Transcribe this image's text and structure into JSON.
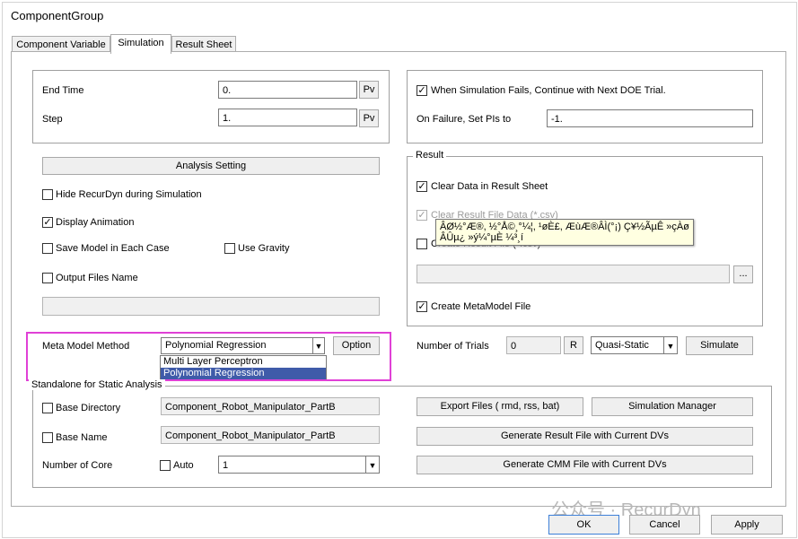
{
  "window": {
    "title": "ComponentGroup"
  },
  "tabs": [
    "Component Variable",
    "Simulation",
    "Result Sheet"
  ],
  "time": {
    "end_time_label": "End Time",
    "end_time_value": "0.",
    "pv1": "Pv",
    "step_label": "Step",
    "step_value": "1.",
    "pv2": "Pv"
  },
  "failure": {
    "continue_label": "When Simulation Fails, Continue with Next DOE Trial.",
    "set_pis_label": "On Failure, Set PIs to",
    "set_pis_value": "-1."
  },
  "left_options": {
    "analysis_setting": "Analysis Setting",
    "hide_recurdyn": "Hide RecurDyn during Simulation",
    "display_animation": "Display Animation",
    "save_model": "Save Model in Each Case",
    "use_gravity": "Use Gravity",
    "output_files": "Output Files Name",
    "output_files_value": ""
  },
  "result": {
    "legend": "Result",
    "clear_data": "Clear Data in Result Sheet",
    "clear_result_file": "Clear Result File Data (*.csv)",
    "create_result_file": "Create Result File (*.csv)",
    "browse": "...",
    "create_metamodel": "Create MetaModel File",
    "tooltip_line1": "ÂØ½°Æ®, ½°Å©¸°¼¦, ¹øÈ£, ÆùÆ®ÂÌ(°¡) Ç¥½ÃµÊ »çÀø",
    "tooltip_line2": "ÂÛµ¿ »ý¼°µÈ ¼³¸í"
  },
  "meta_model": {
    "label": "Meta Model Method",
    "selected": "Polynomial Regression",
    "options": [
      "Multi Layer Perceptron",
      "Polynomial Regression"
    ],
    "option_button": "Option"
  },
  "trials": {
    "label": "Number of Trials",
    "value": "0",
    "r_button": "R",
    "mode": "Quasi-Static",
    "simulate": "Simulate"
  },
  "standalone": {
    "legend": "Standalone for Static Analysis",
    "base_directory_label": "Base Directory",
    "base_directory_value": "Component_Robot_Manipulator_PartB",
    "base_name_label": "Base Name",
    "base_name_value": "Component_Robot_Manipulator_PartB",
    "cores_label": "Number of Core",
    "auto_label": "Auto",
    "cores_value": "1",
    "export_files": "Export Files ( rmd, rss, bat)",
    "simulation_manager": "Simulation Manager",
    "gen_result_file": "Generate Result File with Current DVs",
    "gen_cmm_file": "Generate CMM File with Current DVs"
  },
  "footer": {
    "ok": "OK",
    "cancel": "Cancel",
    "apply": "Apply"
  },
  "watermark": "公众号 · RecurDyn",
  "colors": {
    "highlight": "#e040d6",
    "selection": "#3f5ba9",
    "tooltip_bg": "#ffffe1"
  }
}
